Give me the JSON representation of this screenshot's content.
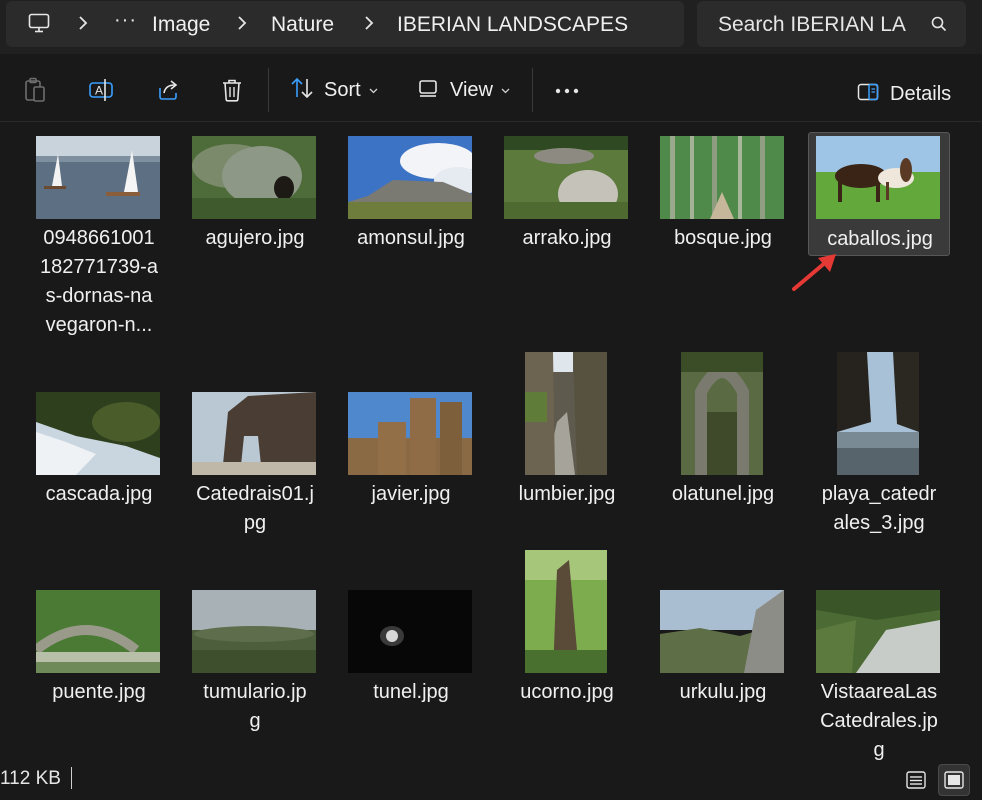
{
  "breadcrumb": {
    "items": [
      "Image",
      "Nature",
      "IBERIAN LANDSCAPES"
    ]
  },
  "search": {
    "placeholder": "Search IBERIAN LA"
  },
  "toolbar": {
    "sort_label": "Sort",
    "view_label": "View",
    "details_label": "Details"
  },
  "files": [
    {
      "name": "0948661001182771739-as-dornas-navegaron-n...",
      "lines": [
        "0948661001",
        "182771739-a",
        "s-dornas-na",
        "vegaron-n..."
      ]
    },
    {
      "name": "agujero.jpg",
      "lines": [
        "agujero.jpg"
      ]
    },
    {
      "name": "amonsul.jpg",
      "lines": [
        "amonsul.jpg"
      ]
    },
    {
      "name": "arrako.jpg",
      "lines": [
        "arrako.jpg"
      ]
    },
    {
      "name": "bosque.jpg",
      "lines": [
        "bosque.jpg"
      ]
    },
    {
      "name": "caballos.jpg",
      "lines": [
        "caballos.jpg"
      ],
      "selected": true
    },
    {
      "name": "cascada.jpg",
      "lines": [
        "cascada.jpg"
      ]
    },
    {
      "name": "Catedrais01.jpg",
      "lines": [
        "Catedrais01.j",
        "pg"
      ]
    },
    {
      "name": "javier.jpg",
      "lines": [
        "javier.jpg"
      ]
    },
    {
      "name": "lumbier.jpg",
      "lines": [
        "lumbier.jpg"
      ]
    },
    {
      "name": "olatunel.jpg",
      "lines": [
        "olatunel.jpg"
      ]
    },
    {
      "name": "playa_catedrales_3.jpg",
      "lines": [
        "playa_catedr",
        "ales_3.jpg"
      ]
    },
    {
      "name": "puente.jpg",
      "lines": [
        "puente.jpg"
      ]
    },
    {
      "name": "tumulario.jpg",
      "lines": [
        "tumulario.jp",
        "g"
      ]
    },
    {
      "name": "tunel.jpg",
      "lines": [
        "tunel.jpg"
      ]
    },
    {
      "name": "ucorno.jpg",
      "lines": [
        "ucorno.jpg"
      ]
    },
    {
      "name": "urkulu.jpg",
      "lines": [
        "urkulu.jpg"
      ]
    },
    {
      "name": "VistaareaLasCatedrales.jpg",
      "lines": [
        "VistaareaLas",
        "Catedrales.jp",
        "g"
      ]
    }
  ],
  "status": {
    "size_text": "112 KB"
  },
  "icons": {
    "computer": "monitor-icon",
    "chevron": "chevron-right-icon",
    "more": "ellipsis-icon",
    "search": "search-icon",
    "paste": "clipboard-icon",
    "rename": "rename-icon",
    "share": "share-icon",
    "delete": "trash-icon",
    "sort": "sort-icon",
    "view": "view-icon",
    "details": "details-pane-icon",
    "list_view": "list-view-icon",
    "tile_view": "tile-view-icon",
    "annotation": "red-arrow-icon"
  },
  "colors": {
    "background": "#191919",
    "panel": "#2b2b2b",
    "selection": "#3a3a3a",
    "annotation": "#e53935"
  }
}
